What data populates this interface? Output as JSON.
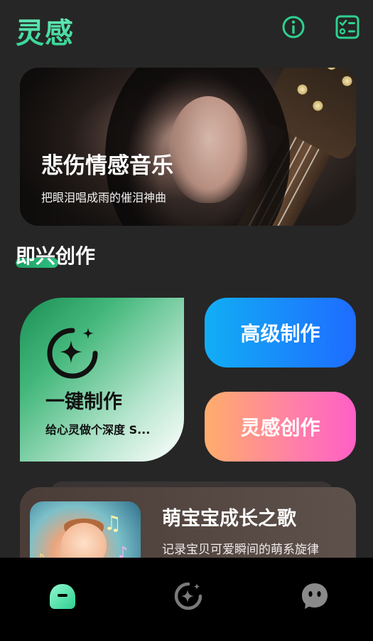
{
  "header": {
    "app_title": "灵感",
    "icons": [
      "info-icon",
      "checklist-icon"
    ]
  },
  "banner": {
    "title": "悲伤情感音乐",
    "subtitle": "把眼泪唱成雨的催泪神曲"
  },
  "section": {
    "title": "即兴创作"
  },
  "cards": {
    "one_click": {
      "title": "一键制作",
      "subtitle": "给心灵做个深度 S...",
      "icon": "sparkle-icon"
    },
    "advanced": {
      "label": "高级制作"
    },
    "inspire": {
      "label": "灵感创作"
    }
  },
  "feed": {
    "title": "萌宝宝成长之歌",
    "subtitle": "记录宝贝可爱瞬间的萌系旋律"
  },
  "tabbar": {
    "tabs": [
      "home-icon",
      "discover-icon",
      "chat-icon"
    ],
    "active": "home-icon"
  },
  "colors": {
    "accent_green": "#2fd08f",
    "background": "#262626",
    "tabbar": "#000000",
    "advanced_start": "#12aef5",
    "advanced_end": "#1e6cff",
    "inspire_start": "#ffad6b",
    "inspire_end": "#ff5fc6"
  }
}
